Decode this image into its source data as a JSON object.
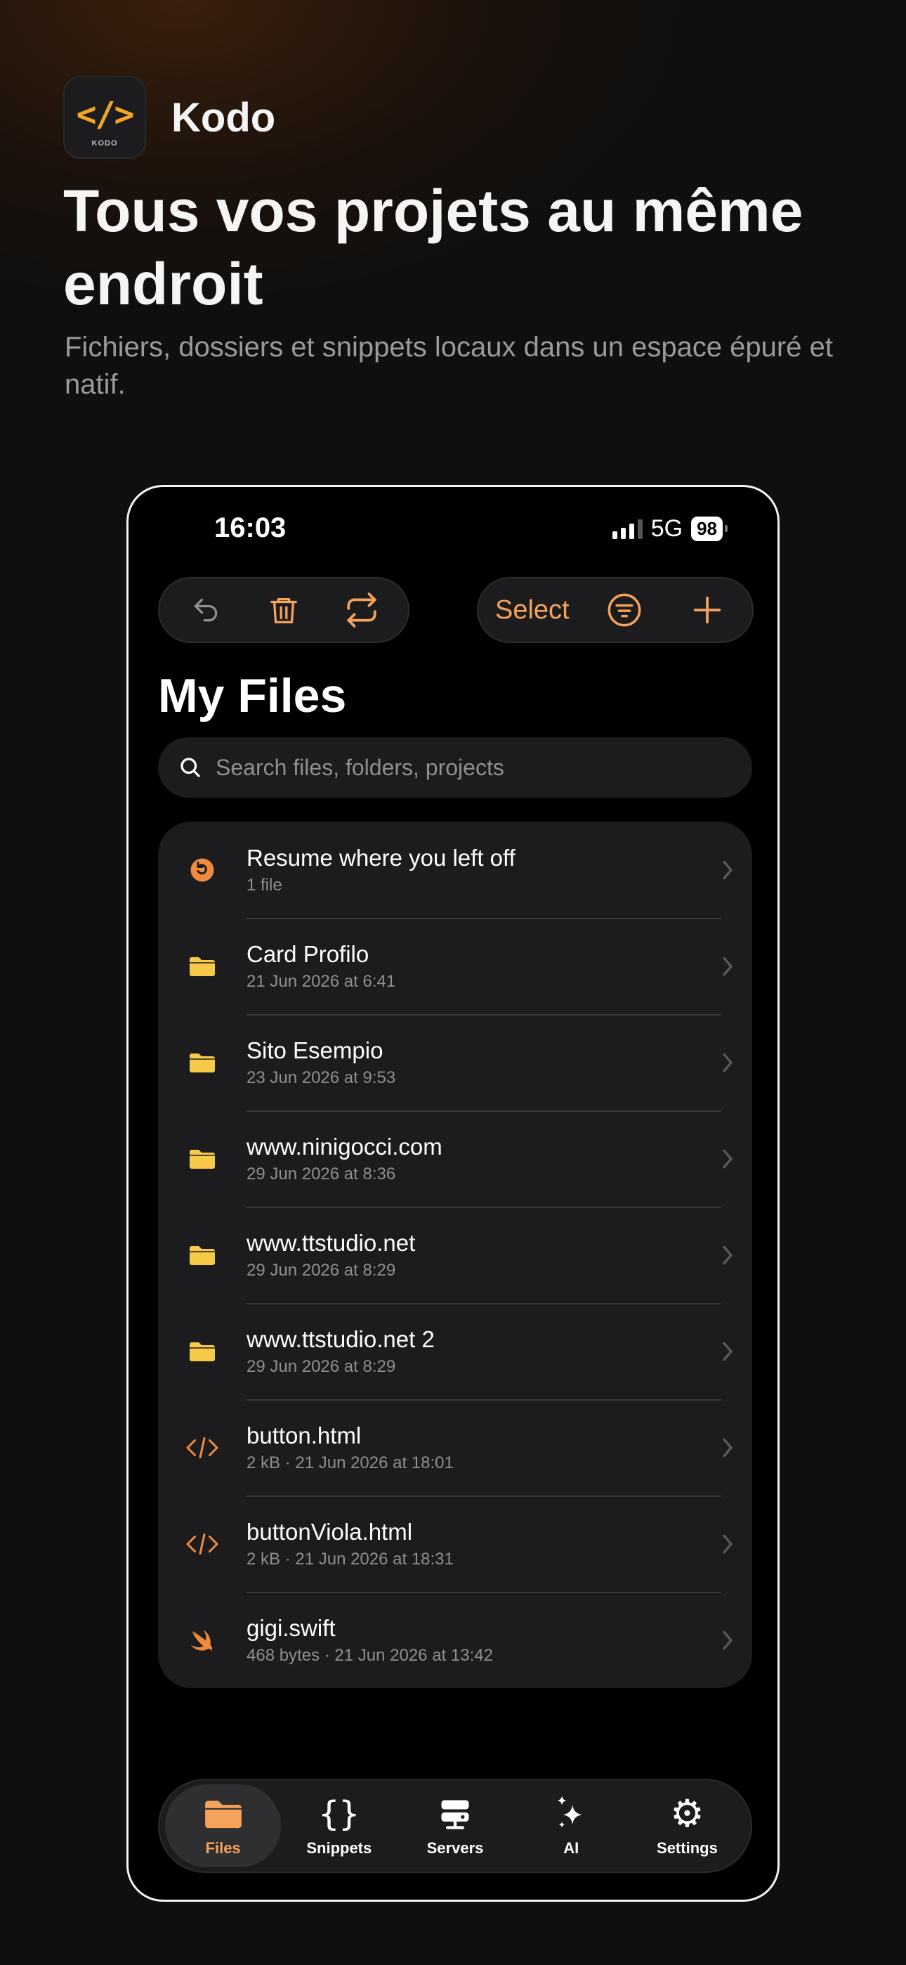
{
  "promo": {
    "app_name": "Kodo",
    "icon_glyph": "</>",
    "icon_caption": "KODO",
    "headline": "Tous vos projets au même endroit",
    "subline": "Fichiers, dossiers et snippets locaux dans un espace épuré et natif."
  },
  "status_bar": {
    "time": "16:03",
    "network": "5G",
    "battery": "98"
  },
  "toolbar": {
    "left_icons": [
      "undo-icon",
      "trash-icon",
      "sync-icon"
    ],
    "select_label": "Select",
    "right_icons": [
      "filter-icon",
      "plus-icon"
    ]
  },
  "page": {
    "title": "My Files"
  },
  "search": {
    "placeholder": "Search files, folders, projects"
  },
  "items": [
    {
      "name": "Resume where you left off",
      "meta": "1 file",
      "icon": "resume-icon"
    },
    {
      "name": "Card Profilo",
      "meta": "21 Jun 2026 at 6:41",
      "icon": "folder-icon"
    },
    {
      "name": "Sito Esempio",
      "meta": "23 Jun 2026 at 9:53",
      "icon": "folder-icon"
    },
    {
      "name": "www.ninigocci.com",
      "meta": "29 Jun 2026 at 8:36",
      "icon": "folder-icon"
    },
    {
      "name": "www.ttstudio.net",
      "meta": "29 Jun 2026 at 8:29",
      "icon": "folder-icon"
    },
    {
      "name": "www.ttstudio.net 2",
      "meta": "29 Jun 2026 at 8:29",
      "icon": "folder-icon"
    },
    {
      "name": "button.html",
      "meta": "2 kB · 21 Jun 2026 at 18:01",
      "icon": "html-file-icon"
    },
    {
      "name": "buttonViola.html",
      "meta": "2 kB · 21 Jun 2026 at 18:31",
      "icon": "html-file-icon"
    },
    {
      "name": "gigi.swift",
      "meta": "468 bytes · 21 Jun 2026 at 13:42",
      "icon": "swift-file-icon"
    }
  ],
  "tabs": [
    {
      "label": "Files",
      "icon": "folder-icon",
      "active": true
    },
    {
      "label": "Snippets",
      "icon": "braces-icon",
      "active": false
    },
    {
      "label": "Servers",
      "icon": "server-icon",
      "active": false
    },
    {
      "label": "AI",
      "icon": "sparkles-icon",
      "active": false
    },
    {
      "label": "Settings",
      "icon": "gear-icon",
      "active": false
    }
  ],
  "colors": {
    "accent": "#f5a35b",
    "folder": "#f7c948",
    "background": "#000000",
    "card": "#1c1c1e"
  }
}
